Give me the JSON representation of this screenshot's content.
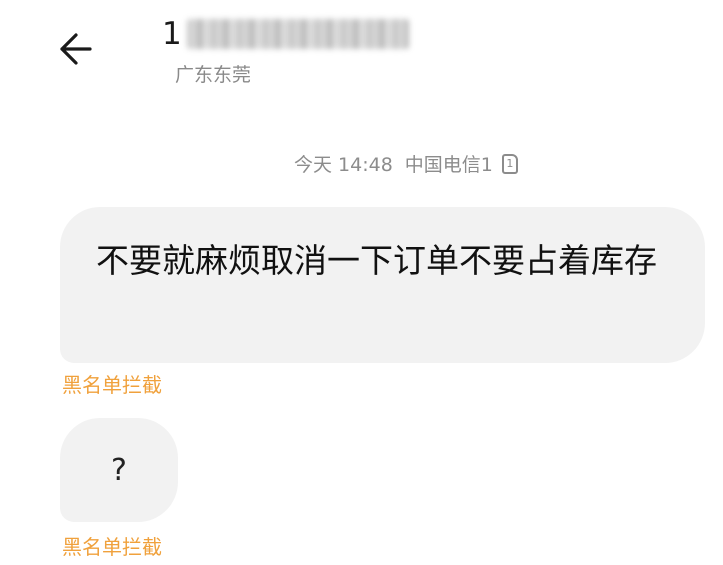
{
  "header": {
    "back_icon": "arrow-left-icon",
    "contact_number_visible": "1",
    "contact_location": "广东东莞"
  },
  "timestamp": {
    "time": "今天 14:48",
    "carrier": "中国电信1",
    "sim_icon": "sim-card-icon",
    "sim_label": "1"
  },
  "messages": [
    {
      "text": "不要就麻烦取消一下订单不要占着库存",
      "status": "黑名单拦截"
    },
    {
      "text": "?",
      "status": "黑名单拦截"
    }
  ],
  "colors": {
    "bubble_background": "#f2f2f2",
    "blocked_label": "#f0a13c",
    "secondary_text": "#8c8c8c"
  }
}
